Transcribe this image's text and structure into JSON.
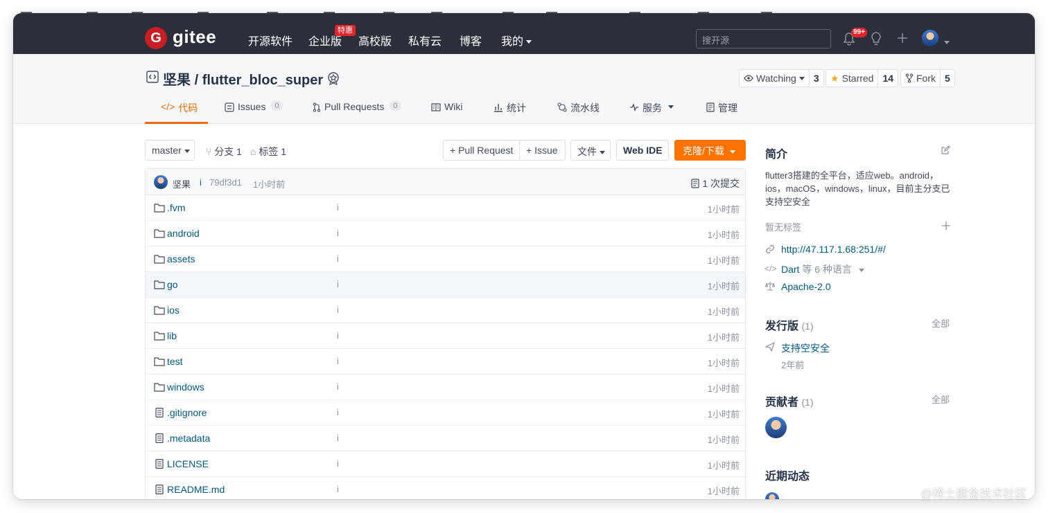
{
  "nav": {
    "brand": "gitee",
    "items": [
      "开源软件",
      "企业版",
      "高校版",
      "私有云",
      "博客",
      "我的"
    ],
    "enterprise_badge": "特惠",
    "search_placeholder": "搜开源",
    "notif_count": "99+"
  },
  "repo": {
    "owner": "坚果",
    "separator": "/",
    "name": "flutter_bloc_super",
    "watching_label": "Watching",
    "watching_count": "3",
    "starred_label": "Starred",
    "starred_count": "14",
    "fork_label": "Fork",
    "fork_count": "5"
  },
  "tabs": [
    {
      "label": "代码"
    },
    {
      "label": "Issues",
      "count": "0"
    },
    {
      "label": "Pull Requests",
      "count": "0"
    },
    {
      "label": "Wiki"
    },
    {
      "label": "统计"
    },
    {
      "label": "流水线"
    },
    {
      "label": "服务"
    },
    {
      "label": "管理"
    }
  ],
  "toolbar": {
    "branch": "master",
    "branches": "分支 1",
    "tags": "标签 1",
    "pull_request": "+ Pull Request",
    "issue": "+ Issue",
    "file_menu": "文件",
    "web_ide": "Web IDE",
    "clone": "克隆/下载"
  },
  "commit": {
    "author": "坚果",
    "message": "i",
    "hash": "79df3d1",
    "time": "1小时前",
    "count": "1 次提交"
  },
  "files": [
    {
      "name": ".fvm",
      "type": "folder",
      "message": "i",
      "time": "1小时前"
    },
    {
      "name": "android",
      "type": "folder",
      "message": "i",
      "time": "1小时前"
    },
    {
      "name": "assets",
      "type": "folder",
      "message": "i",
      "time": "1小时前"
    },
    {
      "name": "go",
      "type": "folder",
      "message": "i",
      "time": "1小时前"
    },
    {
      "name": "ios",
      "type": "folder",
      "message": "i",
      "time": "1小时前"
    },
    {
      "name": "lib",
      "type": "folder",
      "message": "i",
      "time": "1小时前"
    },
    {
      "name": "test",
      "type": "folder",
      "message": "i",
      "time": "1小时前"
    },
    {
      "name": "windows",
      "type": "folder",
      "message": "i",
      "time": "1小时前"
    },
    {
      "name": ".gitignore",
      "type": "file",
      "message": "i",
      "time": "1小时前"
    },
    {
      "name": ".metadata",
      "type": "file",
      "message": "i",
      "time": "1小时前"
    },
    {
      "name": "LICENSE",
      "type": "file",
      "message": "i",
      "time": "1小时前"
    },
    {
      "name": "README.md",
      "type": "file",
      "message": "i",
      "time": "1小时前"
    }
  ],
  "sidebar": {
    "intro_title": "简介",
    "intro_text": "flutter3搭建的全平台，适应web。android，ios，macOS，windows，linux，目前主分支已支持空安全",
    "no_tags": "暂无标签",
    "homepage": "http://47.117.1.68:251/#/",
    "language_main": "Dart",
    "language_more": "等 6 种语言",
    "license": "Apache-2.0",
    "releases_title": "发行版",
    "releases_count": "(1)",
    "releases_all": "全部",
    "release_name": "支持空安全",
    "release_time": "2年前",
    "contributors_title": "贡献者",
    "contributors_count": "(1)",
    "contributors_all": "全部",
    "activity_title": "近期动态"
  },
  "watermark": "@稀土掘金技术社区",
  "colors": {
    "nav_bg": "#2a2f3a",
    "accent": "#fe7300",
    "link": "#005980",
    "logo_red": "#c71d23"
  }
}
